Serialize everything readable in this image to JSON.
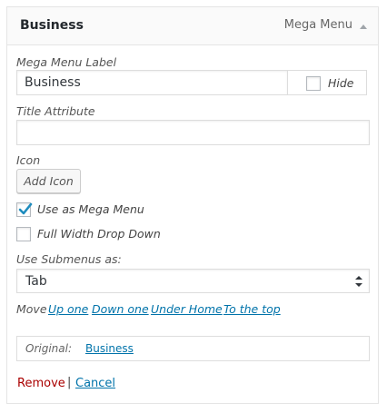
{
  "header": {
    "title": "Business",
    "item_type": "Mega Menu",
    "toggle_icon": "caret-up-icon"
  },
  "menu_label": {
    "label": "Mega Menu Label",
    "value": "Business",
    "hide_label": "Hide",
    "hide_checked": false
  },
  "title_attribute": {
    "label": "Title Attribute",
    "value": ""
  },
  "icon": {
    "label": "Icon",
    "button_label": "Add Icon"
  },
  "options": {
    "use_as_mega_menu": {
      "label": "Use as Mega Menu",
      "checked": true
    },
    "full_width_drop_down": {
      "label": "Full Width Drop Down",
      "checked": false
    }
  },
  "submenus": {
    "label": "Use Submenus as:",
    "selected": "Tab"
  },
  "move": {
    "label": "Move",
    "links": [
      "Up one",
      "Down one",
      "Under Home",
      "To the top"
    ]
  },
  "original": {
    "label": "Original:",
    "link": "Business"
  },
  "actions": {
    "remove": "Remove",
    "separator": "|",
    "cancel": "Cancel"
  },
  "colors": {
    "link": "#0073aa",
    "remove": "#aa0000",
    "border": "#dddddd"
  }
}
